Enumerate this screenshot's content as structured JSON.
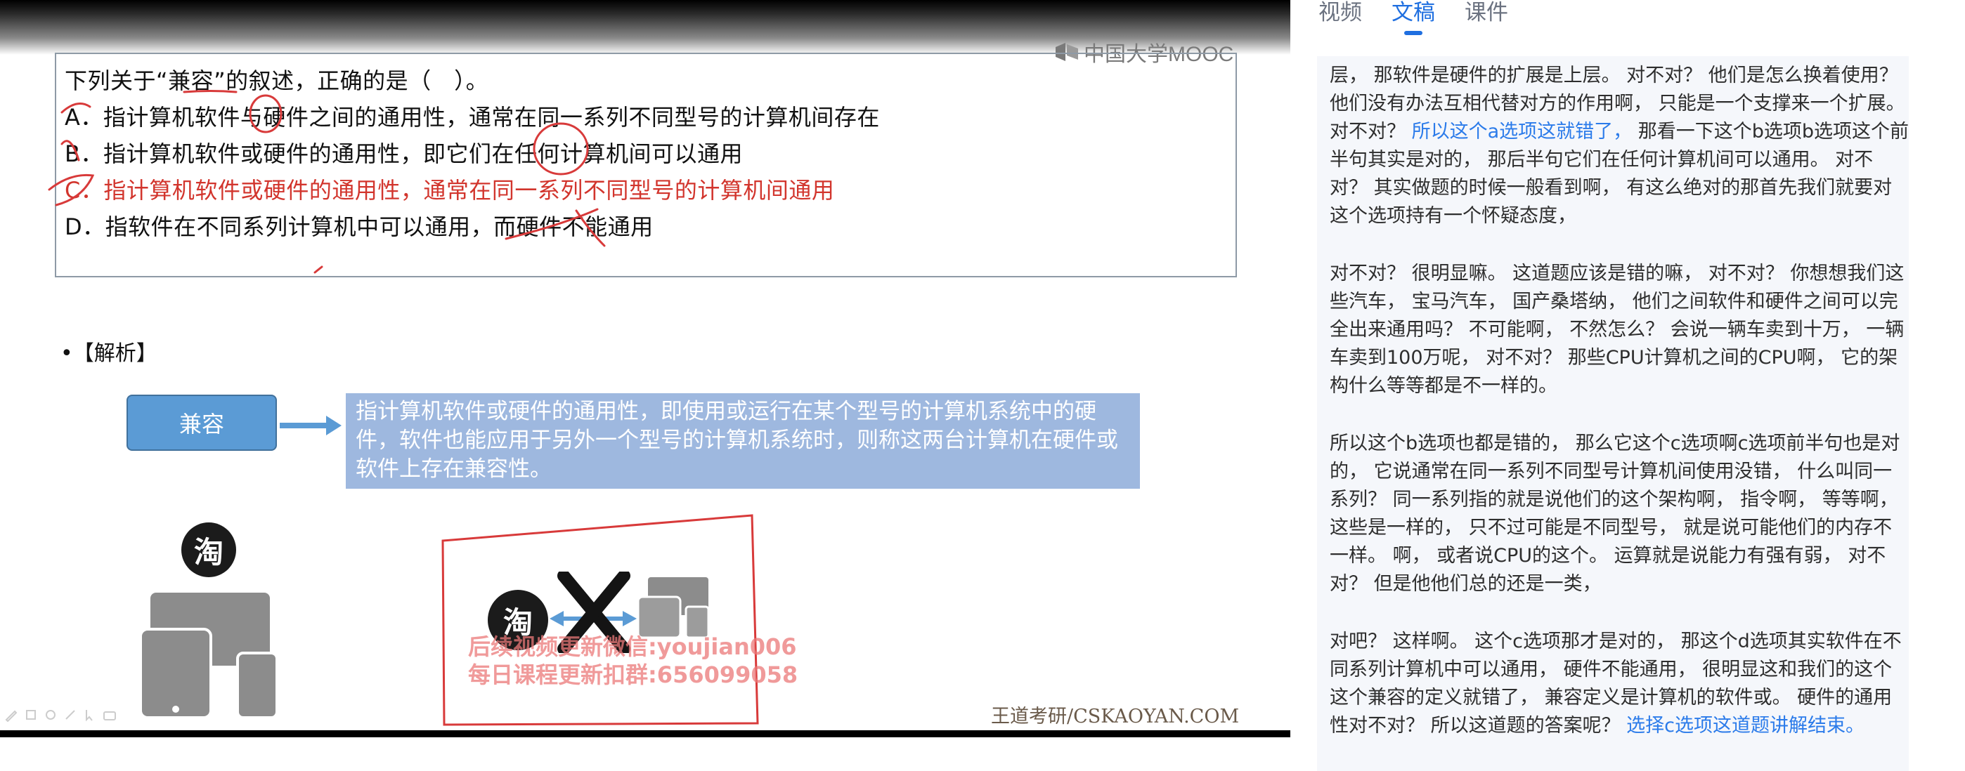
{
  "player": {
    "logo_text": "中国大学MOOC",
    "question": {
      "stem": "下列关于“兼容”的叙述，正确的是（　）。",
      "options": [
        "A．指计算机软件与硬件之间的通用性，通常在同一系列不同型号的计算机间存在",
        "B．指计算机软件或硬件的通用性，即它们在任何计算机间可以通用",
        "C．指计算机软件或硬件的通用性，通常在同一系列不同型号的计算机间通用",
        "D．指软件在不同系列计算机中可以通用，而硬件不能通用"
      ]
    },
    "analysis_title": "•【解析】",
    "concept_label": "兼容",
    "definition": "指计算机软件或硬件的通用性，即使用或运行在某个型号的计算机系统中的硬件，软件也能应用于另外一个型号的计算机系统时，则称这两台计算机在硬件或软件上存在兼容性。",
    "tao_glyph": "淘",
    "watermark_line1": "后续视频更新微信:youjian006",
    "watermark_line2": "每日课程更新扣群:656099058",
    "source": "王道考研/CSKAOYAN.COM",
    "colors": {
      "correct_option": "#d2352d",
      "concept_box": "#5b9bd5",
      "definition_box": "#9eb8df",
      "annotation": "#d83a3a"
    }
  },
  "sidebar": {
    "tabs": [
      {
        "label": "视频",
        "active": false
      },
      {
        "label": "文稿",
        "active": true
      },
      {
        "label": "课件",
        "active": false
      }
    ],
    "accent": "#1f6fe0",
    "paragraphs": [
      {
        "pre": "层， 那软件是硬件的扩展是上层。 对不对？ 他们是怎么换着使用？ 他们没有办法互相代替对方的作用啊， 只能是一个支撑来一个扩展。 对不对？ ",
        "hl": "所以这个a选项这就错了，",
        "post": " 那看一下这个b选项b选项这个前半句其实是对的， 那后半句它们在任何计算机间可以通用。 对不对？ 其实做题的时候一般看到啊， 有这么绝对的那首先我们就要对这个选项持有一个怀疑态度，"
      },
      {
        "pre": "对不对？ 很明显嘛。 这道题应该是错的嘛， 对不对？ 你想想我们这些汽车， 宝马汽车， 国产桑塔纳， 他们之间软件和硬件之间可以完全出来通用吗？ 不可能啊， 不然怎么？ 会说一辆车卖到十万， 一辆车卖到100万呢， 对不对？ 那些CPU计算机之间的CPU啊， 它的架构什么等等都是不一样的。",
        "hl": "",
        "post": ""
      },
      {
        "pre": "所以这个b选项也都是错的， 那么它这个c选项啊c选项前半句也是对的， 它说通常在同一系列不同型号计算机间使用没错， 什么叫同一系列？ 同一系列指的就是说他们的这个架构啊， 指令啊， 等等啊， 这些是一样的， 只不过可能是不同型号， 就是说可能他们的内存不一样。 啊， 或者说CPU的这个。 运算就是说能力有强有弱， 对不对？ 但是他他们总的还是一类，",
        "hl": "",
        "post": ""
      },
      {
        "pre": "对吧？ 这样啊。 这个c选项那才是对的， 那这个d选项其实软件在不同系列计算机中可以通用， 硬件不能通用， 很明显这和我们的这个这个兼容的定义就错了， 兼容定义是计算机的软件或。 硬件的通用性对不对？ 所以这道题的答案呢？ ",
        "hl": "选择c选项这道题讲解结束。",
        "post": ""
      }
    ]
  }
}
